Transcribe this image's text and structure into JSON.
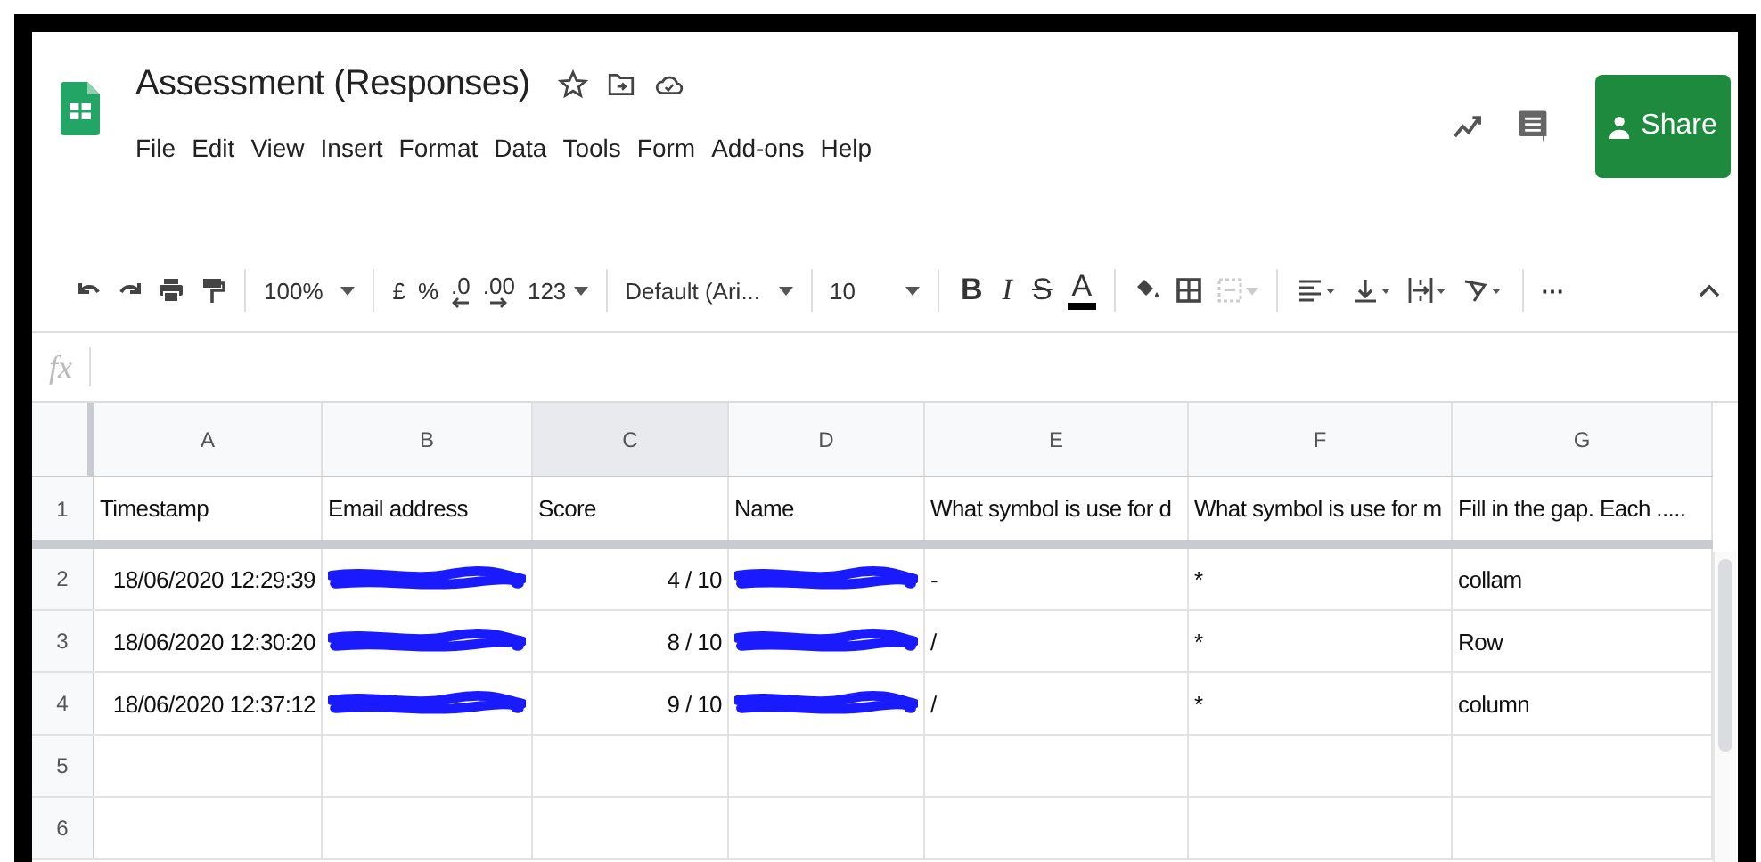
{
  "app": {
    "title": "Assessment (Responses)",
    "menu": [
      "File",
      "Edit",
      "View",
      "Insert",
      "Format",
      "Data",
      "Tools",
      "Form",
      "Add-ons",
      "Help"
    ],
    "share_button": "Share"
  },
  "toolbar": {
    "zoom": "100%",
    "currency": "£",
    "percent": "%",
    "decrease_decimals": ".0",
    "increase_decimals": ".00",
    "number_format": "123",
    "font": "Default (Ari...",
    "font_size": "10",
    "bold": "B",
    "italic": "I",
    "strikethrough": "S",
    "text_color": "A",
    "more": "⋯"
  },
  "formula_bar": {
    "label": "fx"
  },
  "sheet": {
    "columns": [
      {
        "label": "A",
        "selected": false
      },
      {
        "label": "B",
        "selected": false
      },
      {
        "label": "C",
        "selected": true
      },
      {
        "label": "D",
        "selected": false
      },
      {
        "label": "E",
        "selected": false
      },
      {
        "label": "F",
        "selected": false
      },
      {
        "label": "G",
        "selected": false
      }
    ],
    "rows": [
      {
        "number": "1",
        "cells": [
          {
            "kind": "text",
            "text": "Timestamp"
          },
          {
            "kind": "text",
            "text": "Email address"
          },
          {
            "kind": "text",
            "text": "Score"
          },
          {
            "kind": "text",
            "text": "Name"
          },
          {
            "kind": "text",
            "text": "What symbol is use for d"
          },
          {
            "kind": "text",
            "text": "What symbol is use for m"
          },
          {
            "kind": "text",
            "text": "Fill in the gap. Each ....."
          }
        ]
      },
      {
        "number": "2",
        "cells": [
          {
            "kind": "number",
            "text": "18/06/2020 12:29:39"
          },
          {
            "kind": "redacted"
          },
          {
            "kind": "number",
            "text": "4 / 10"
          },
          {
            "kind": "redacted"
          },
          {
            "kind": "text",
            "text": "-"
          },
          {
            "kind": "text",
            "text": "*"
          },
          {
            "kind": "text",
            "text": "collam"
          }
        ]
      },
      {
        "number": "3",
        "cells": [
          {
            "kind": "number",
            "text": "18/06/2020 12:30:20"
          },
          {
            "kind": "redacted"
          },
          {
            "kind": "number",
            "text": "8 / 10"
          },
          {
            "kind": "redacted"
          },
          {
            "kind": "text",
            "text": "/"
          },
          {
            "kind": "text",
            "text": "*"
          },
          {
            "kind": "text",
            "text": "Row"
          }
        ]
      },
      {
        "number": "4",
        "cells": [
          {
            "kind": "number",
            "text": "18/06/2020 12:37:12"
          },
          {
            "kind": "redacted"
          },
          {
            "kind": "number",
            "text": "9 / 10"
          },
          {
            "kind": "redacted"
          },
          {
            "kind": "text",
            "text": "/"
          },
          {
            "kind": "text",
            "text": "*"
          },
          {
            "kind": "text",
            "text": "column"
          }
        ]
      },
      {
        "number": "5"
      },
      {
        "number": "6"
      }
    ]
  }
}
